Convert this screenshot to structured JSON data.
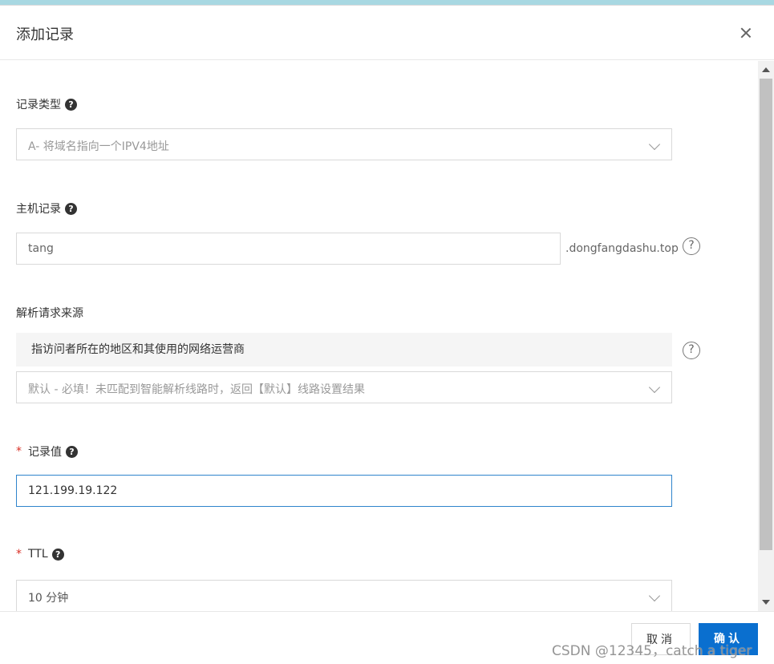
{
  "dialog": {
    "title": "添加记录"
  },
  "record_type": {
    "label": "记录类型",
    "value": "A- 将域名指向一个IPV4地址"
  },
  "host_record": {
    "label": "主机记录",
    "value": "tang",
    "suffix": ".dongfangdashu.top"
  },
  "resolve_source": {
    "label": "解析请求来源",
    "info": "指访问者所在的地区和其使用的网络运营商",
    "value": "默认 - 必填！未匹配到智能解析线路时，返回【默认】线路设置结果"
  },
  "record_value": {
    "required_mark": "*",
    "label": "记录值",
    "value": "121.199.19.122"
  },
  "ttl": {
    "required_mark": "*",
    "label": "TTL",
    "value": "10 分钟"
  },
  "help_glyph": "?",
  "footer": {
    "cancel_label": "取消",
    "ok_label": "确认",
    "watermark": "CSDN @12345，catch a tiger"
  },
  "colors": {
    "accent": "#0a6fcf",
    "focus_border": "#2f84cc",
    "required": "#d93026"
  },
  "icons": [
    "close-icon",
    "question-dot-icon",
    "chevron-down-icon",
    "help-circle-icon"
  ]
}
